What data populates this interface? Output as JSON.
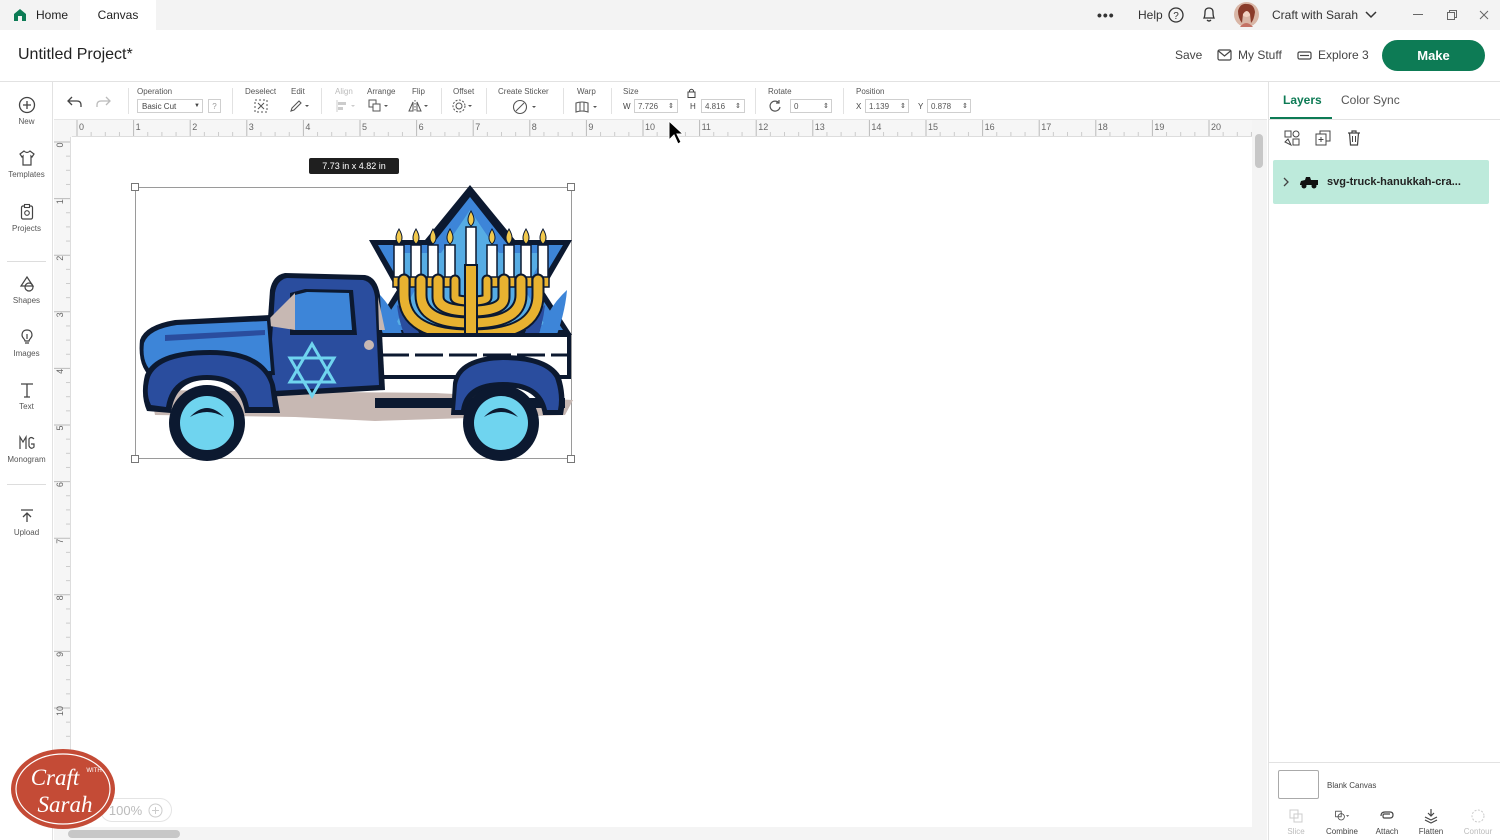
{
  "tabs": {
    "home": "Home",
    "canvas": "Canvas"
  },
  "topbar": {
    "more": "•••",
    "help": "Help",
    "user_name": "Craft with Sarah"
  },
  "header": {
    "title": "Untitled Project*",
    "save": "Save",
    "my_stuff": "My Stuff",
    "machine": "Explore 3",
    "make": "Make"
  },
  "sidebar": {
    "items": [
      {
        "label": "New",
        "icon": "plus-circle-icon"
      },
      {
        "label": "Templates",
        "icon": "tshirt-icon"
      },
      {
        "label": "Projects",
        "icon": "clipboard-icon"
      },
      {
        "label": "Shapes",
        "icon": "shapes-icon"
      },
      {
        "label": "Images",
        "icon": "lightbulb-icon"
      },
      {
        "label": "Text",
        "icon": "text-icon"
      },
      {
        "label": "Monogram",
        "icon": "monogram-icon"
      },
      {
        "label": "Upload",
        "icon": "upload-icon"
      }
    ]
  },
  "toolbar": {
    "operation_label": "Operation",
    "operation_value": "Basic Cut",
    "operation_help": "?",
    "deselect_label": "Deselect",
    "edit_label": "Edit",
    "align_label": "Align",
    "arrange_label": "Arrange",
    "flip_label": "Flip",
    "offset_label": "Offset",
    "sticker_label": "Create Sticker",
    "warp_label": "Warp",
    "size_label": "Size",
    "w_label": "W",
    "w_value": "7.726",
    "h_label": "H",
    "h_value": "4.816",
    "rotate_label": "Rotate",
    "rotate_value": "0",
    "position_label": "Position",
    "x_label": "X",
    "x_value": "1.139",
    "y_label": "Y",
    "y_value": "0.878"
  },
  "ruler": {
    "h_ticks": [
      "0",
      "1",
      "2",
      "3",
      "4",
      "5",
      "6",
      "7",
      "8",
      "9",
      "10",
      "11",
      "12",
      "13",
      "14",
      "15",
      "16",
      "17",
      "18",
      "19",
      "20"
    ],
    "v_ticks": [
      "0",
      "1",
      "2",
      "3",
      "4",
      "5",
      "6",
      "7",
      "8",
      "9",
      "10"
    ]
  },
  "canvas": {
    "size_tooltip": "7.73  in x 4.82  in",
    "zoom": "100%"
  },
  "panel": {
    "tab_layers": "Layers",
    "tab_colorsync": "Color Sync",
    "layer_name": "svg-truck-hanukkah-cra...",
    "blank_canvas": "Blank Canvas",
    "actions": [
      "Slice",
      "Combine",
      "Attach",
      "Flatten",
      "Contour"
    ]
  },
  "watermark": {
    "line1": "Craft",
    "with": "WITH",
    "line2": "Sarah"
  },
  "colors": {
    "accent": "#0d7b55",
    "layer_bg": "#bdeadb",
    "truck_blue": "#2a4d9e",
    "truck_light": "#3d85d8",
    "gold": "#e8b230",
    "light_blue": "#6fd4ef"
  }
}
